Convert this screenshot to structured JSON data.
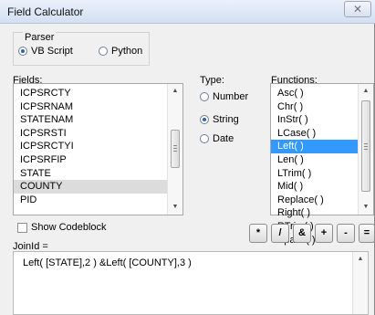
{
  "window": {
    "title": "Field Calculator",
    "close_glyph": "✕"
  },
  "parser": {
    "label": "Parser",
    "options": [
      {
        "label": "VB Script",
        "selected": true
      },
      {
        "label": "Python",
        "selected": false
      }
    ]
  },
  "fields": {
    "label": "Fields:",
    "items": [
      "ICPSRCTY",
      "ICPSRNAM",
      "STATENAM",
      "ICPSRSTI",
      "ICPSRCTYI",
      "ICPSRFIP",
      "STATE",
      "COUNTY",
      "PID"
    ],
    "selected": "COUNTY"
  },
  "type": {
    "label": "Type:",
    "options": [
      {
        "label": "Number",
        "selected": false
      },
      {
        "label": "String",
        "selected": true
      },
      {
        "label": "Date",
        "selected": false
      }
    ]
  },
  "functions": {
    "label": "Functions:",
    "items": [
      "Asc( )",
      "Chr( )",
      "InStr( )",
      "LCase( )",
      "Left( )",
      "Len( )",
      "LTrim( )",
      "Mid( )",
      "Replace( )",
      "Right( )",
      "RTrim( )",
      "Space( )"
    ],
    "selected": "Left( )"
  },
  "codeblock": {
    "label": "Show Codeblock",
    "checked": false
  },
  "target_label": "JoinId =",
  "operators": [
    "*",
    "/",
    "&",
    "+",
    "-",
    "="
  ],
  "expression": "Left( [STATE],2 ) &Left( [COUNTY],3 )"
}
